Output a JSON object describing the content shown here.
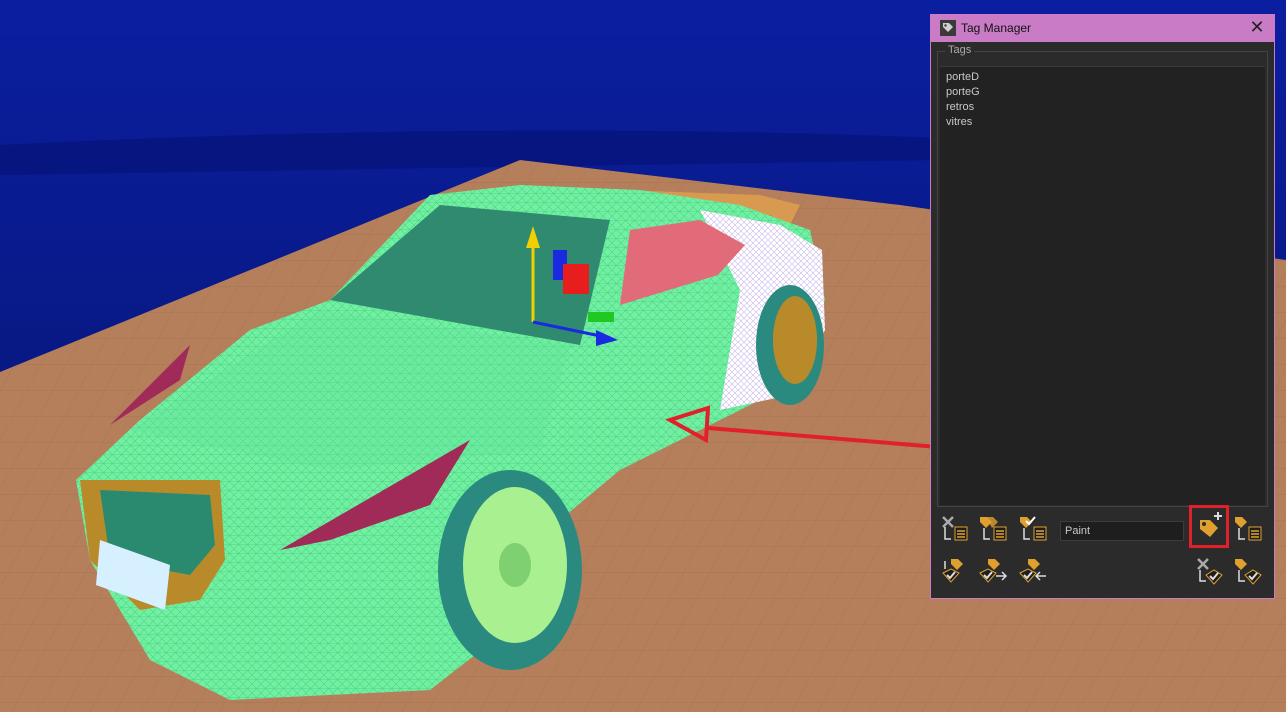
{
  "window": {
    "title": "Tag Manager",
    "title_icon": "tag-icon",
    "close_glyph": "✕",
    "accent_color": "#c97cc5"
  },
  "tags_group": {
    "label": "Tags",
    "items": [
      "porteD",
      "porteG",
      "retros",
      "vitres"
    ]
  },
  "name_field": {
    "value": "Paint"
  },
  "annotations": {
    "arrow_color": "#e0212b",
    "highlight_color": "#e0212b"
  },
  "viewport": {
    "sky_color": "#0a1a8c",
    "floor_color": "#b57f5b",
    "wireframe_color": "#6ef0a0"
  }
}
